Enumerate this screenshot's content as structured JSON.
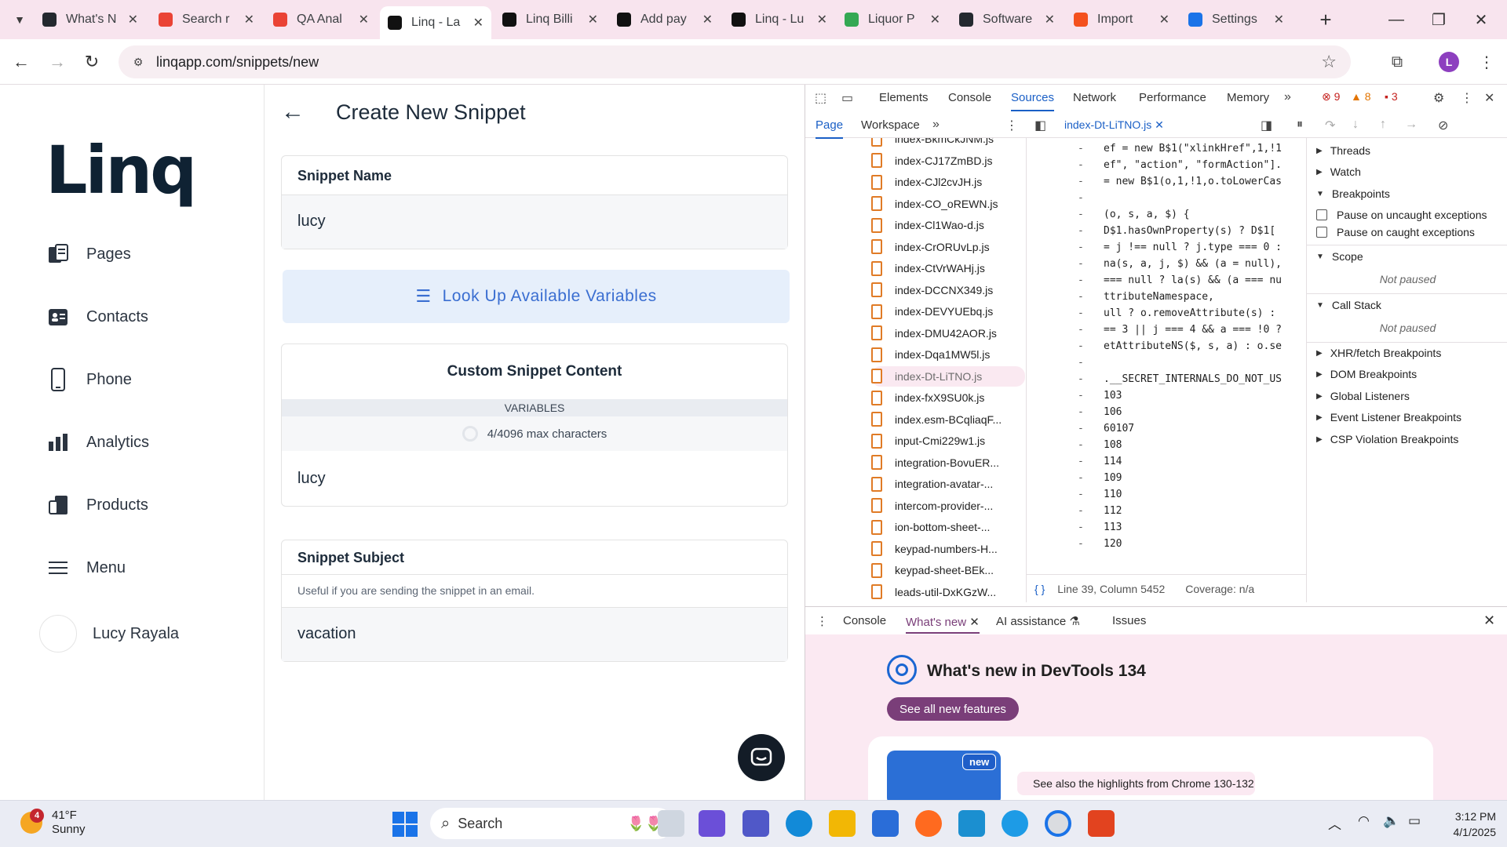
{
  "browser": {
    "tabs": [
      {
        "label": "What's N",
        "icon": "github-icon",
        "color": "#24292f"
      },
      {
        "label": "Search r",
        "icon": "gmail-icon",
        "color": "#ea4335"
      },
      {
        "label": "QA Anal",
        "icon": "gmail-icon",
        "color": "#ea4335"
      },
      {
        "label": "Linq - La",
        "icon": "linq-icon",
        "color": "#111111"
      },
      {
        "label": "Linq Billi",
        "icon": "linq-icon",
        "color": "#111111"
      },
      {
        "label": "Add pay",
        "icon": "linq-icon",
        "color": "#111111"
      },
      {
        "label": "Linq - Lu",
        "icon": "linq-icon",
        "color": "#111111"
      },
      {
        "label": "Liquor P",
        "icon": "drive-icon",
        "color": "#34a853"
      },
      {
        "label": "Software",
        "icon": "github-icon",
        "color": "#24292f"
      },
      {
        "label": "Import",
        "icon": "import-icon",
        "color": "#f4511e"
      },
      {
        "label": "Settings",
        "icon": "gear-icon",
        "color": "#1a73e8"
      }
    ],
    "active_tab_index": 3,
    "url": "linqapp.com/snippets/new",
    "profile_initial": "L"
  },
  "sidebar": {
    "logo": "Linq",
    "items": [
      {
        "label": "Pages",
        "icon": "pages-icon"
      },
      {
        "label": "Contacts",
        "icon": "contacts-icon"
      },
      {
        "label": "Phone",
        "icon": "phone-icon"
      },
      {
        "label": "Analytics",
        "icon": "analytics-icon"
      },
      {
        "label": "Products",
        "icon": "products-icon"
      },
      {
        "label": "Menu",
        "icon": "menu-icon"
      }
    ],
    "user_name": "Lucy Rayala"
  },
  "main": {
    "title": "Create New Snippet",
    "snippet_name": {
      "label": "Snippet Name",
      "value": "lucy"
    },
    "lookup_button": "Look Up Available Variables",
    "content": {
      "label": "Custom Snippet Content",
      "variables_label": "VARIABLES",
      "char_count": "4/4096 max characters",
      "value": "lucy"
    },
    "subject": {
      "label": "Snippet Subject",
      "hint": "Useful if you are sending the snippet in an email.",
      "value": "vacation"
    }
  },
  "devtools": {
    "tabs": [
      "Elements",
      "Console",
      "Sources",
      "Network",
      "Performance",
      "Memory"
    ],
    "active_tab": "Sources",
    "errors": "9",
    "warnings": "8",
    "issues": "3",
    "sub_tabs": [
      "Page",
      "Workspace"
    ],
    "open_file": "index-Dt-LiTNO.js",
    "files": [
      "index-BkmCkJNM.js",
      "index-CJ17ZmBD.js",
      "index-CJl2cvJH.js",
      "index-CO_oREWN.js",
      "index-Cl1Wao-d.js",
      "index-CrORUvLp.js",
      "index-CtVrWAHj.js",
      "index-DCCNX349.js",
      "index-DEVYUEbq.js",
      "index-DMU42AOR.js",
      "index-Dqa1MW5l.js",
      "index-Dt-LiTNO.js",
      "index-fxX9SU0k.js",
      "index.esm-BCqliaqF...",
      "input-Cmi229w1.js",
      "integration-BovuER...",
      "integration-avatar-...",
      "intercom-provider-...",
      "ion-bottom-sheet-...",
      "keypad-numbers-H...",
      "keypad-sheet-BEk...",
      "leads-util-DxKGzW..."
    ],
    "selected_file_index": 11,
    "code_lines": [
      "ef = new B$1(\"xlinkHref\",1,!1",
      "ef\", \"action\", \"formAction\"].",
      "= new B$1(o,1,!1,o.toLowerCas",
      "",
      "(o, s, a, $) {",
      "D$1.hasOwnProperty(s) ? D$1[",
      "= j !== null ? j.type === 0 :",
      "na(s, a, j, $) && (a = null),",
      "=== null ? la(s) && (a === nu",
      "ttributeNamespace,",
      "ull ? o.removeAttribute(s) :",
      "== 3 || j === 4 && a === !0 ?",
      "etAttributeNS($, s, a) : o.se",
      "",
      ".__SECRET_INTERNALS_DO_NOT_US",
      "103",
      "106",
      "60107",
      "108",
      "114",
      "109",
      "110",
      "112",
      "113",
      "120"
    ],
    "cursor_position": "Line 39, Column 5452",
    "coverage": "Coverage: n/a",
    "debugger": {
      "threads": "Threads",
      "watch": "Watch",
      "breakpoints": "Breakpoints",
      "pause_uncaught": "Pause on uncaught exceptions",
      "pause_caught": "Pause on caught exceptions",
      "scope": "Scope",
      "not_paused_1": "Not paused",
      "call_stack": "Call Stack",
      "not_paused_2": "Not paused",
      "xhr": "XHR/fetch Breakpoints",
      "dom": "DOM Breakpoints",
      "global": "Global Listeners",
      "event": "Event Listener Breakpoints",
      "csp": "CSP Violation Breakpoints"
    },
    "drawer_tabs": [
      "Console",
      "What's new",
      "AI assistance",
      "Issues"
    ],
    "active_drawer_tab": "What's new",
    "whats_new_title": "What's new in DevTools 134",
    "see_all_button": "See all new features",
    "new_badge": "new",
    "highlight_text": "See also the highlights from Chrome 130-132"
  },
  "taskbar": {
    "weather_badge": "4",
    "temperature": "41°F",
    "condition": "Sunny",
    "search_placeholder": "Search",
    "time": "3:12 PM",
    "date": "4/1/2025"
  }
}
